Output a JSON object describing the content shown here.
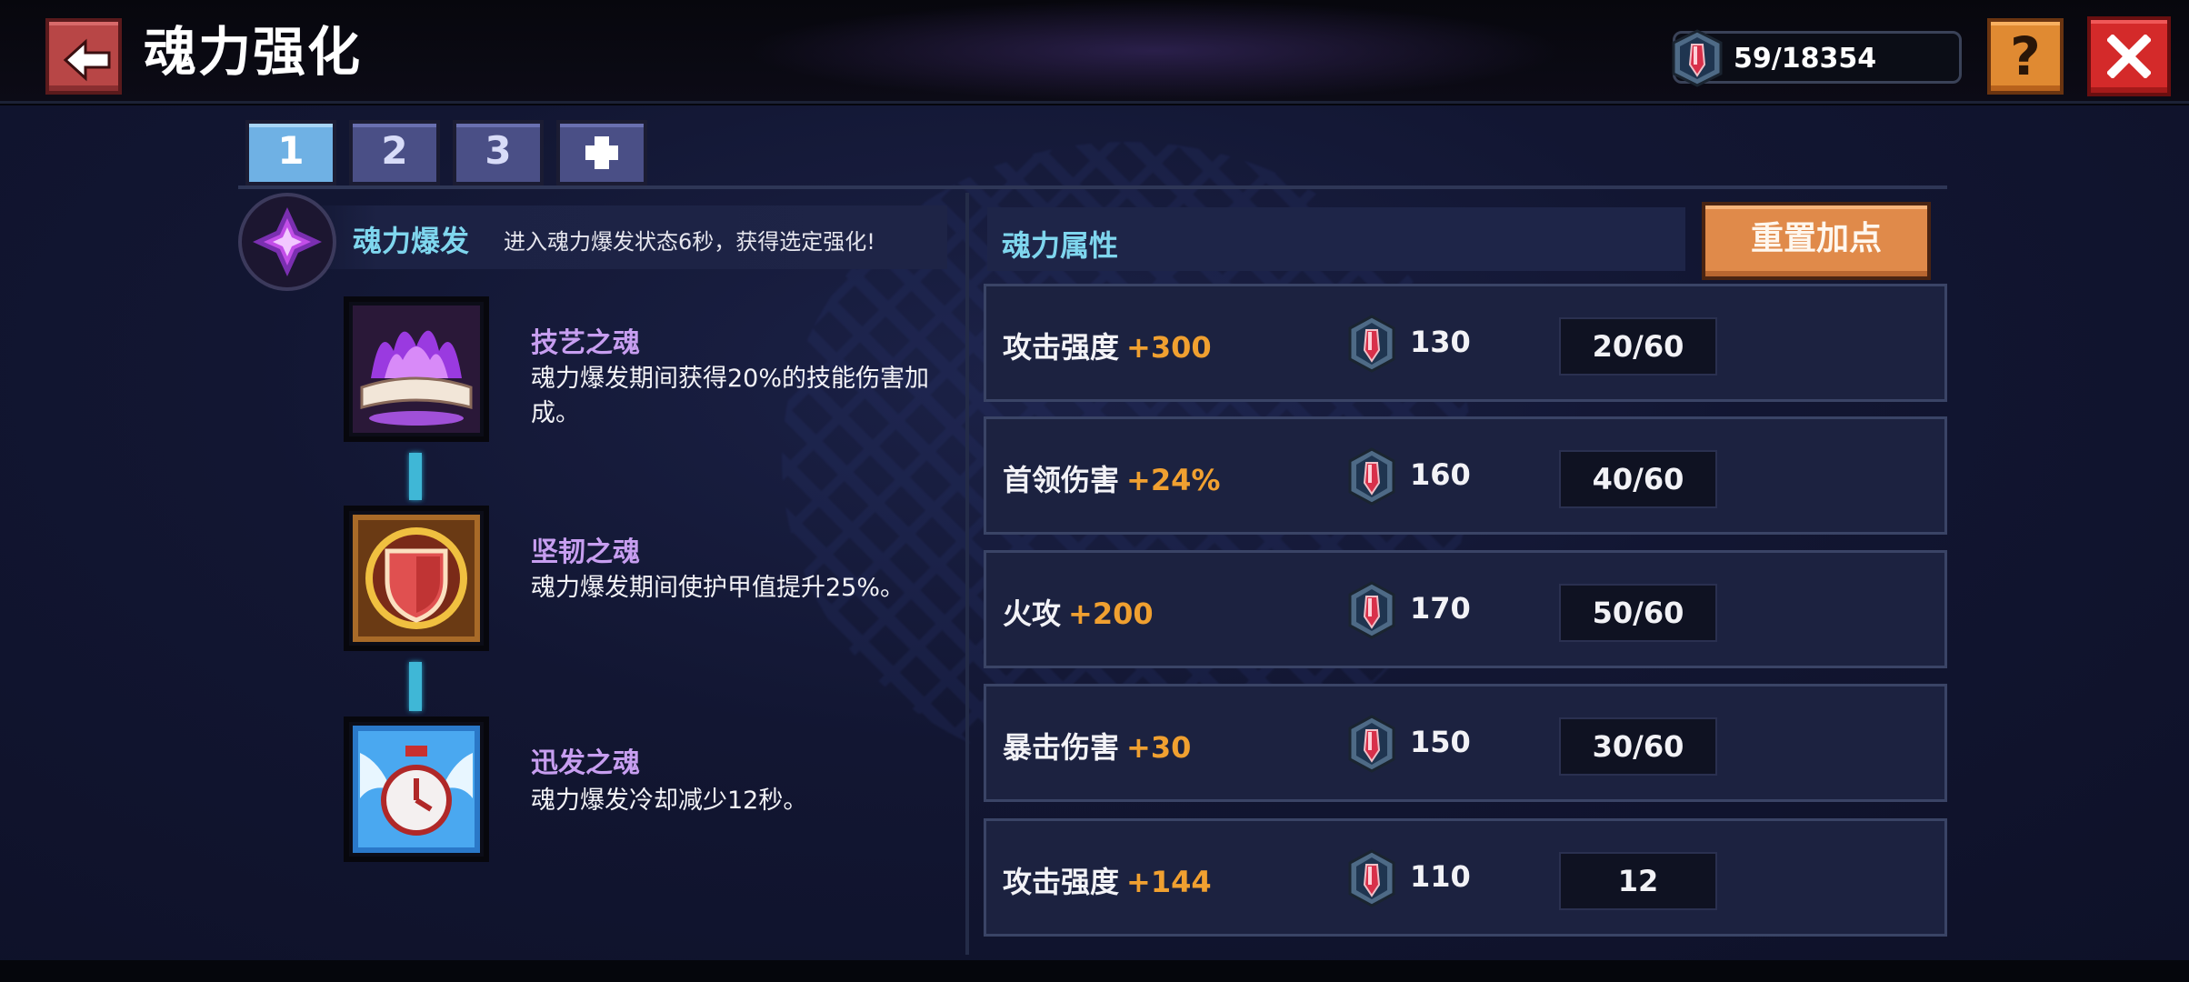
{
  "header": {
    "title": "魂力强化",
    "currency_value": "59/18354",
    "help_label": "?"
  },
  "tabs": [
    {
      "label": "1",
      "active": true
    },
    {
      "label": "2",
      "active": false
    },
    {
      "label": "3",
      "active": false
    },
    {
      "label": "+",
      "active": false
    }
  ],
  "burst": {
    "title": "魂力爆发",
    "description": "进入魂力爆发状态6秒，获得选定强化!"
  },
  "skills": [
    {
      "name": "技艺之魂",
      "description": "魂力爆发期间获得20%的技能伤害加成。",
      "icon": "purple-flame-book-icon"
    },
    {
      "name": "坚韧之魂",
      "description": "魂力爆发期间使护甲值提升25%。",
      "icon": "red-shield-icon"
    },
    {
      "name": "迅发之魂",
      "description": "魂力爆发冷却减少12秒。",
      "icon": "winged-clock-icon"
    }
  ],
  "attributes": {
    "title": "魂力属性",
    "reset_label": "重置加点",
    "rows": [
      {
        "name": "攻击强度",
        "bonus": "+300",
        "cost": "130",
        "level": "20/60"
      },
      {
        "name": "首领伤害",
        "bonus": "+24%",
        "cost": "160",
        "level": "40/60"
      },
      {
        "name": "火攻",
        "bonus": "+200",
        "cost": "170",
        "level": "50/60"
      },
      {
        "name": "暴击伤害",
        "bonus": "+30",
        "cost": "150",
        "level": "30/60"
      },
      {
        "name": "攻击强度",
        "bonus": "+144",
        "cost": "110",
        "level": "12"
      }
    ]
  },
  "colors": {
    "accent_cyan": "#7fd6ee",
    "bonus_orange": "#f0a030",
    "skill_name_purple": "#c79ef0",
    "tab_active": "#6fb1e4",
    "tab_inactive": "#4a4f86"
  }
}
